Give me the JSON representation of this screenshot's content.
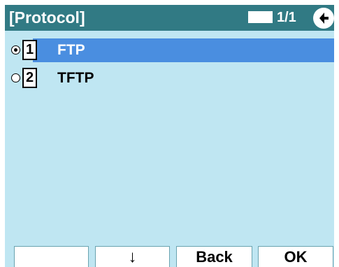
{
  "header": {
    "title": "[Protocol]",
    "page_count": "1/1",
    "back_icon": "back-arrow-icon"
  },
  "menu": {
    "items": [
      {
        "number": "1",
        "label": "FTP",
        "selected": true
      },
      {
        "number": "2",
        "label": "TFTP",
        "selected": false
      }
    ]
  },
  "softkeys": {
    "key1": "",
    "key2": "↓",
    "key3": "Back",
    "key4": "OK"
  },
  "colors": {
    "background": "#bfe6f2",
    "titlebar": "#317a84",
    "highlight": "#4a8ee0"
  }
}
